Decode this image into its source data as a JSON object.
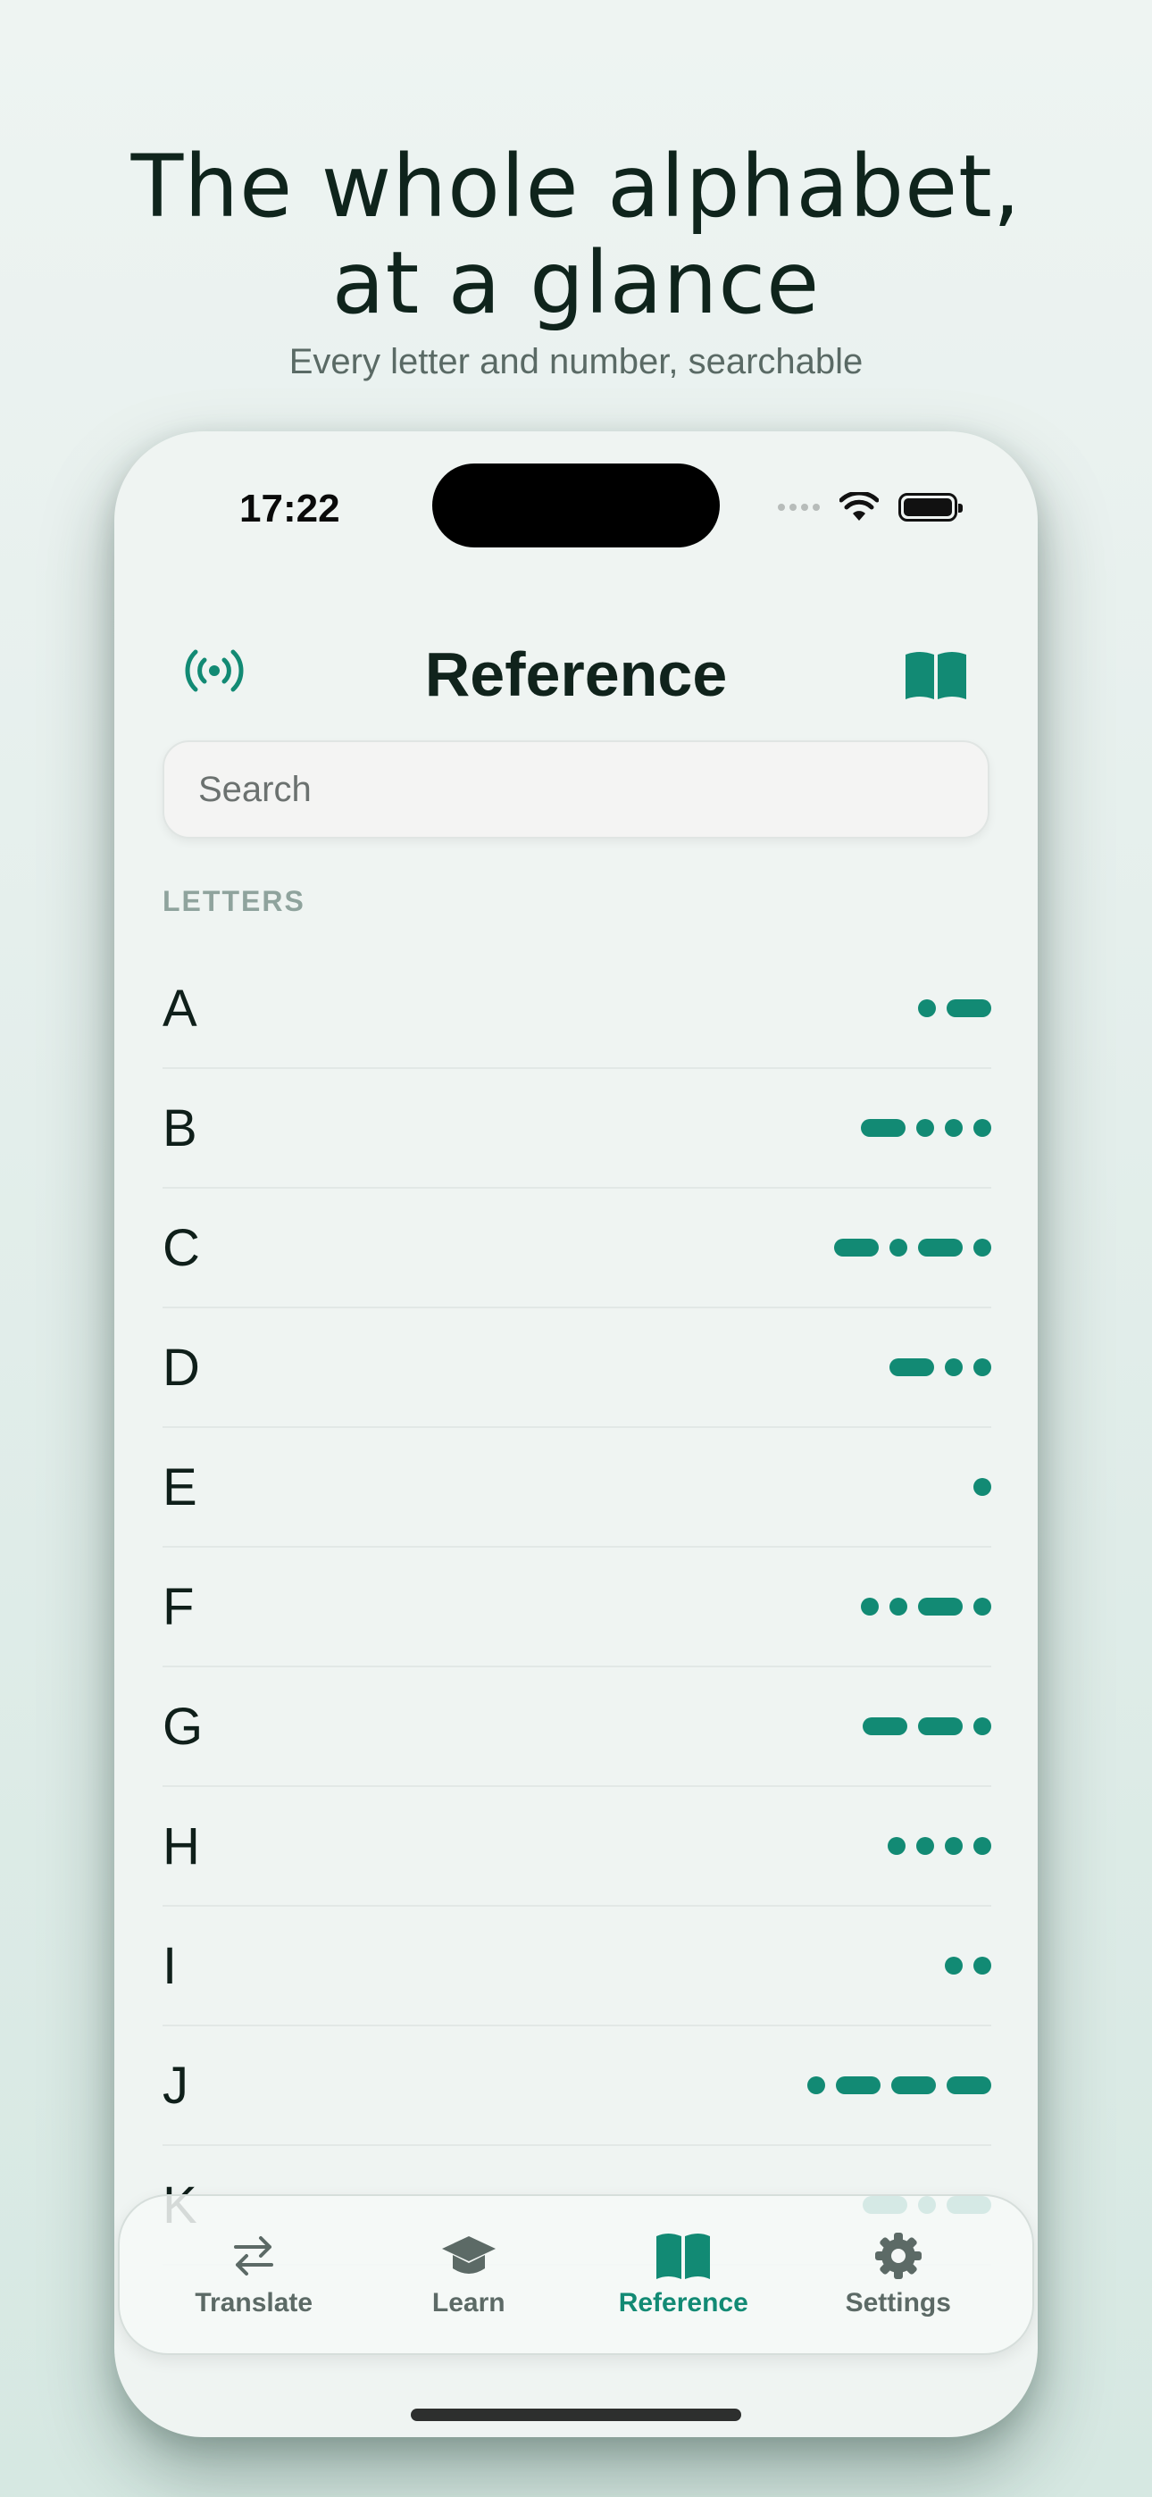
{
  "promo": {
    "headline_line1": "The whole alphabet,",
    "headline_line2": "at a glance",
    "subtitle": "Every letter and number, searchable"
  },
  "status_bar": {
    "time": "17:22"
  },
  "nav": {
    "title": "Reference",
    "left_icon": "broadcast-icon",
    "right_icon": "book-icon"
  },
  "search": {
    "placeholder": "Search"
  },
  "section": {
    "title": "LETTERS"
  },
  "letters": [
    {
      "letter": "A",
      "code": ".-"
    },
    {
      "letter": "B",
      "code": "-..."
    },
    {
      "letter": "C",
      "code": "-.-."
    },
    {
      "letter": "D",
      "code": "-.."
    },
    {
      "letter": "E",
      "code": "."
    },
    {
      "letter": "F",
      "code": "..-."
    },
    {
      "letter": "G",
      "code": "--."
    },
    {
      "letter": "H",
      "code": "...."
    },
    {
      "letter": "I",
      "code": ".."
    },
    {
      "letter": "J",
      "code": ".---"
    },
    {
      "letter": "K",
      "code": "-.-"
    }
  ],
  "tabs": [
    {
      "label": "Translate",
      "icon": "swap-arrows-icon",
      "active": false
    },
    {
      "label": "Learn",
      "icon": "graduation-cap-icon",
      "active": false
    },
    {
      "label": "Reference",
      "icon": "book-icon",
      "active": true
    },
    {
      "label": "Settings",
      "icon": "gear-icon",
      "active": false
    }
  ],
  "colors": {
    "accent": "#128a74",
    "text": "#10231c",
    "muted": "#8fa39d"
  }
}
